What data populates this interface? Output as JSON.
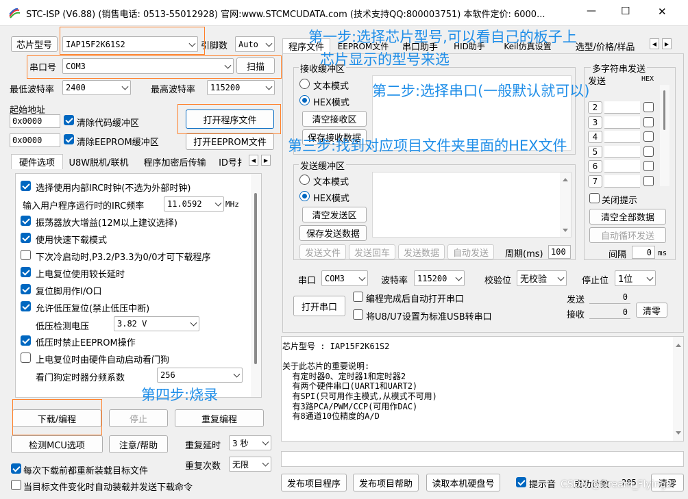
{
  "window": {
    "title": "STC-ISP (V6.88) (销售电话: 0513-55012928) 官网:www.STCMCUDATA.com  (技术支持QQ:800003751) 本软件定价: 6000...",
    "minimize": "—",
    "maximize": "☐",
    "close": "✕"
  },
  "left": {
    "chip_label": "芯片型号",
    "chip_value": "IAP15F2K61S2",
    "pins_label": "引脚数",
    "pins_value": "Auto",
    "port_label": "串口号",
    "port_value": "COM3",
    "scan_button": "扫描",
    "min_baud_label": "最低波特率",
    "min_baud_value": "2400",
    "max_baud_label": "最高波特率",
    "max_baud_value": "115200",
    "start_addr_label": "起始地址",
    "addr1": "0x0000",
    "addr2": "0x0000",
    "clear_code": "清除代码缓冲区",
    "clear_eeprom": "清除EEPROM缓冲区",
    "open_program": "打开程序文件",
    "open_eeprom": "打开EEPROM文件",
    "tabs": [
      "硬件选项",
      "U8W脱机/联机",
      "程序加密后传输",
      "ID号扌"
    ],
    "options": {
      "irc": "选择使用内部IRC时钟(不选为外部时钟)",
      "irc_freq_label": "输入用户程序运行时的IRC频率",
      "irc_freq_value": "11.0592",
      "irc_unit": "MHz",
      "amp": "振荡器放大增益(12M以上建议选择)",
      "fast": "使用快速下载模式",
      "cold": "下次冷启动时,P3.2/P3.3为0/0才可下载程序",
      "delay": "上电复位使用较长延时",
      "reset_io": "复位脚用作I/O口",
      "lvr": "允许低压复位(禁止低压中断)",
      "lv_label": "低压检测电压",
      "lv_value": "3.82 V",
      "lv_eeprom": "低压时禁止EEPROM操作",
      "wdt": "上电复位时由硬件自动启动看门狗",
      "wdt_div_label": "看门狗定时器分频系数",
      "wdt_div_value": "256"
    },
    "download": "下载/编程",
    "stop": "停止",
    "repeat_prog": "重复编程",
    "detect": "检测MCU选项",
    "help": "注意/帮助",
    "repeat_delay_label": "重复延时",
    "repeat_delay_value": "3 秒",
    "repeat_count_label": "重复次数",
    "repeat_count_value": "无限",
    "reload_each": "每次下载前都重新装载目标文件",
    "auto_reload": "当目标文件变化时自动装载并发送下载命令"
  },
  "right": {
    "tabs": [
      "程序文件",
      "EEPROM文件",
      "串口助手",
      "HID助手",
      "Keil仿真设置",
      "选型/价格/样品"
    ],
    "recv_group": "接收缓冲区",
    "text_mode": "文本模式",
    "hex_mode": "HEX模式",
    "clear_recv": "清空接收区",
    "save_recv": "保存接收数据",
    "send_group": "发送缓冲区",
    "clear_send": "清空发送区",
    "save_send": "保存发送数据",
    "send_file": "发送文件",
    "send_enter": "发送回车",
    "send_data": "发送数据",
    "auto_send": "自动发送",
    "period_label": "周期(ms)",
    "period_value": "100",
    "multi_label": "多字符串发送",
    "send_col": "发送",
    "hex_col": "HEX",
    "rows": [
      "2",
      "3",
      "4",
      "5",
      "6",
      "7"
    ],
    "close_tip": "关闭提示",
    "clear_all": "清空全部数据",
    "auto_loop": "自动循环发送",
    "interval_label": "间隔",
    "interval_value": "0",
    "interval_unit": "ms",
    "port_label": "串口",
    "port_value": "COM3",
    "baud_label": "波特率",
    "baud_value": "115200",
    "parity_label": "校验位",
    "parity_value": "无校验",
    "stop_label": "停止位",
    "stop_value": "1位",
    "open_port": "打开串口",
    "auto_open": "编程完成后自动打开串口",
    "usb_set": "将U8/U7设置为标准USB转串口",
    "send_count_label": "发送",
    "send_count": "0",
    "recv_count_label": "接收",
    "recv_count": "0",
    "clear_count": "清零",
    "info_lines": [
      "芯片型号 : IAP15F2K61S2",
      "",
      "关于此芯片的重要说明:",
      "  有定时器0、定时器1和定时器2",
      "  有两个硬件串口(UART1和UART2)",
      "  有SPI(只可用作主模式,从模式不可用)",
      "  有3路PCA/PWM/CCP(可用作DAC)",
      "  有8通道10位精度的A/D"
    ],
    "publish": "发布项目程序",
    "publish_help": "发布项目帮助",
    "read_disk": "读取本机硬盘号",
    "tip_sound": "提示音",
    "success_label": "成功计数",
    "success_value": "205",
    "clear_success": "清零"
  },
  "annotations": {
    "step1a": "第一步:选择芯片型号,可以看自己的板子上",
    "step1b": "芯片显示的型号来选",
    "step2": "第二步:选择串口(一般默认就可以)",
    "step3": "第三步:找到对应项目文件夹里面的HEX文件",
    "step4": "第四步:烧录",
    "watermark": "CSDN @Dream_Flying2"
  },
  "colors": {
    "accent": "#0067c0",
    "annotation": "#1f8ee8",
    "highlight_box": "#ff7f27"
  }
}
